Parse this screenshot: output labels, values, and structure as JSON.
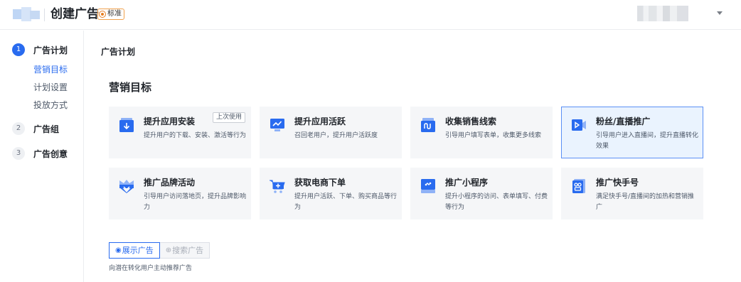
{
  "header": {
    "title": "创建广告",
    "badge": "标准"
  },
  "sidebar": {
    "steps": [
      {
        "num": "1",
        "label": "广告计划"
      },
      {
        "num": "2",
        "label": "广告组"
      },
      {
        "num": "3",
        "label": "广告创意"
      }
    ],
    "substeps": [
      "营销目标",
      "计划设置",
      "投放方式"
    ]
  },
  "main": {
    "section_title": "广告计划",
    "group_title": "营销目标",
    "cards": [
      {
        "title": "提升应用安装",
        "desc": "提升用户的下载、安装、激活等行为",
        "tag": "上次使用",
        "icon": "app-install-icon"
      },
      {
        "title": "提升应用活跃",
        "desc": "召回老用户，提升用户活跃度",
        "icon": "app-active-icon"
      },
      {
        "title": "收集销售线索",
        "desc": "引导用户填写表单，收集更多线索",
        "icon": "sales-lead-icon"
      },
      {
        "title": "粉丝/直播推广",
        "desc": "引导用户进入直播间，提升直播转化效果",
        "icon": "live-stream-icon"
      },
      {
        "title": "推广品牌活动",
        "desc": "引导用户访问落地页，提升品牌影响力",
        "icon": "brand-icon"
      },
      {
        "title": "获取电商下单",
        "desc": "提升用户活跃、下单、购买商品等行为",
        "icon": "cart-icon"
      },
      {
        "title": "推广小程序",
        "desc": "提升小程序的访问、表单填写、付费等行为",
        "icon": "mini-program-icon"
      },
      {
        "title": "推广快手号",
        "desc": "满足快手号/直播间的加热和营销推广",
        "icon": "kuaishou-account-icon"
      }
    ],
    "tabs": [
      {
        "label": "展示广告",
        "icon": "display-icon"
      },
      {
        "label": "搜索广告",
        "icon": "search-icon"
      }
    ],
    "hint": "向潜在转化用户主动推荐广告"
  },
  "colors": {
    "accent": "#296bef",
    "card_bg": "#f5f6f8",
    "selected_bg": "#eaf3fe",
    "badge_border": "#f0a04b"
  }
}
